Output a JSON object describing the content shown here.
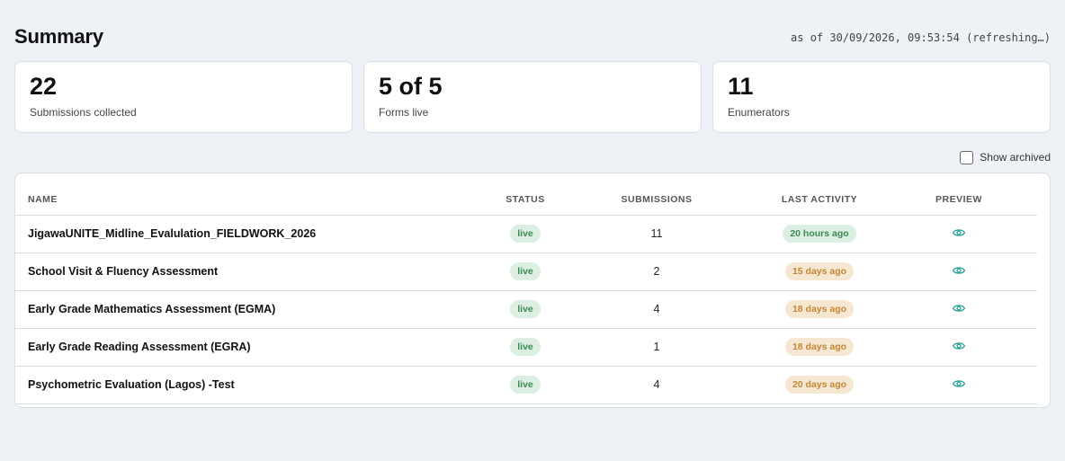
{
  "header": {
    "title": "Summary",
    "as_of": "as of 30/09/2026, 09:53:54 (refreshing…)"
  },
  "stats": [
    {
      "value": "22",
      "label": "Submissions collected"
    },
    {
      "value": "5 of 5",
      "label": "Forms live"
    },
    {
      "value": "11",
      "label": "Enumerators"
    }
  ],
  "archived_toggle": {
    "label": "Show archived",
    "checked": false
  },
  "table": {
    "columns": [
      "Name",
      "Status",
      "Submissions",
      "Last activity",
      "Preview"
    ],
    "rows": [
      {
        "name": "JigawaUNITE_Midline_Evalulation_FIELDWORK_2026",
        "status": "live",
        "submissions": "11",
        "last_activity": "20 hours ago",
        "recency": "green"
      },
      {
        "name": "School Visit & Fluency Assessment",
        "status": "live",
        "submissions": "2",
        "last_activity": "15 days ago",
        "recency": "amber"
      },
      {
        "name": "Early Grade Mathematics Assessment (EGMA)",
        "status": "live",
        "submissions": "4",
        "last_activity": "18 days ago",
        "recency": "amber"
      },
      {
        "name": "Early Grade Reading Assessment (EGRA)",
        "status": "live",
        "submissions": "1",
        "last_activity": "18 days ago",
        "recency": "amber"
      },
      {
        "name": "Psychometric Evaluation (Lagos) -Test",
        "status": "live",
        "submissions": "4",
        "last_activity": "20 days ago",
        "recency": "amber"
      }
    ]
  },
  "icons": {
    "preview": "eye-icon"
  },
  "colors": {
    "live_bg": "#dcefe2",
    "live_text": "#3b8a55",
    "amber_bg": "#f6e7d2",
    "amber_text": "#c58734",
    "eye": "#2aa198"
  }
}
